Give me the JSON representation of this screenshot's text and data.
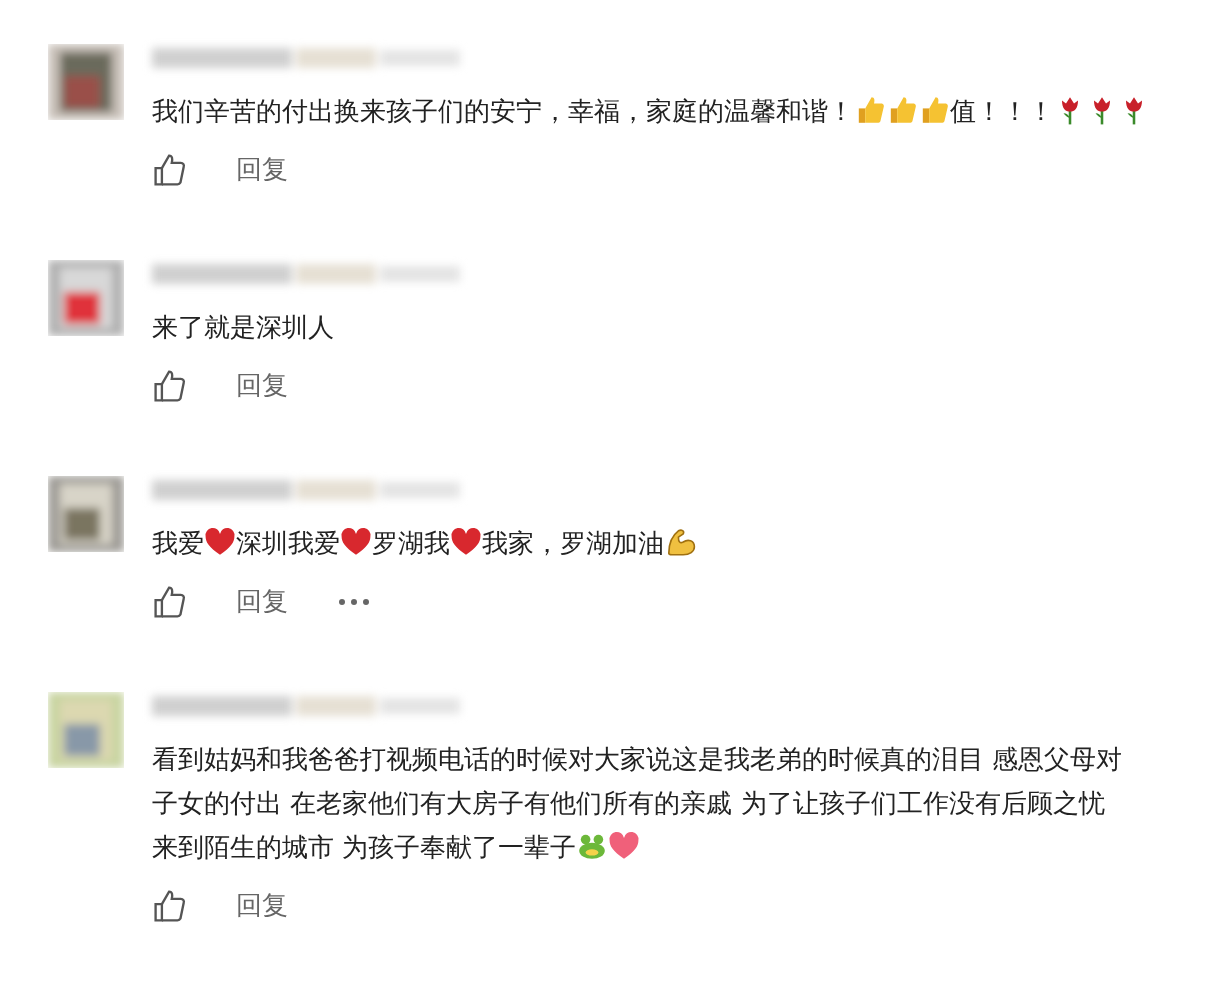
{
  "comments": [
    {
      "content": [
        {
          "kind": "text",
          "text": "我们辛苦的付出换来孩子们的安宁，幸福，家庭的温馨和谐！"
        },
        {
          "kind": "thumbs"
        },
        {
          "kind": "thumbs"
        },
        {
          "kind": "thumbs"
        },
        {
          "kind": "text",
          "text": "值！！！"
        },
        {
          "kind": "rose"
        },
        {
          "kind": "rose"
        },
        {
          "kind": "rose"
        }
      ],
      "reply": "回复",
      "has_more": false
    },
    {
      "content": [
        {
          "kind": "text",
          "text": "来了就是深圳人"
        }
      ],
      "reply": "回复",
      "has_more": false
    },
    {
      "content": [
        {
          "kind": "text",
          "text": "我爱"
        },
        {
          "kind": "heart"
        },
        {
          "kind": "text",
          "text": "深圳我爱"
        },
        {
          "kind": "heart"
        },
        {
          "kind": "text",
          "text": "罗湖我"
        },
        {
          "kind": "heart"
        },
        {
          "kind": "text",
          "text": "我家，罗湖加油"
        },
        {
          "kind": "muscle"
        }
      ],
      "reply": "回复",
      "has_more": true
    },
    {
      "content": [
        {
          "kind": "text",
          "text": "看到姑妈和我爸爸打视频电话的时候对大家说这是我老弟的时候真的泪目 感恩父母对"
        },
        {
          "kind": "text",
          "text": "子女的付出 在老家他们有大房子有他们所有的亲戚 为了让孩子们工作没有后顾之忧"
        },
        {
          "kind": "text",
          "text": "来到陌生的城市 为孩子奉献了一辈子"
        },
        {
          "kind": "frog"
        },
        {
          "kind": "pinkheart"
        }
      ],
      "reply": "回复",
      "has_more": false
    }
  ]
}
